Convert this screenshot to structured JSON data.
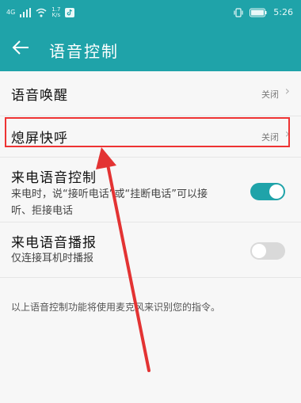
{
  "status_bar": {
    "network": "4G",
    "net_speed_value": "1.7",
    "net_speed_unit": "K/s",
    "time": "5:26"
  },
  "header": {
    "title": "语音控制"
  },
  "settings": {
    "voice_wake": {
      "label": "语音唤醒",
      "value": "关闭"
    },
    "screen_off_call": {
      "label": "熄屏快呼",
      "value": "关闭"
    },
    "incoming_voice_control": {
      "label": "来电语音控制",
      "description": "来电时，说“接听电话”或“挂断电话”可以接听、拒接电话",
      "enabled": true
    },
    "incoming_voice_announce": {
      "label": "来电语音播报",
      "description": "仅连接耳机时播报",
      "enabled": false
    }
  },
  "footer_note": "以上语音控制功能将使用麦克风来识别您的指令。",
  "colors": {
    "primary": "#1fa3a9",
    "toggle_on": "#1fa3a9",
    "toggle_off": "#d9d9d9",
    "annotation": "#e33333"
  }
}
